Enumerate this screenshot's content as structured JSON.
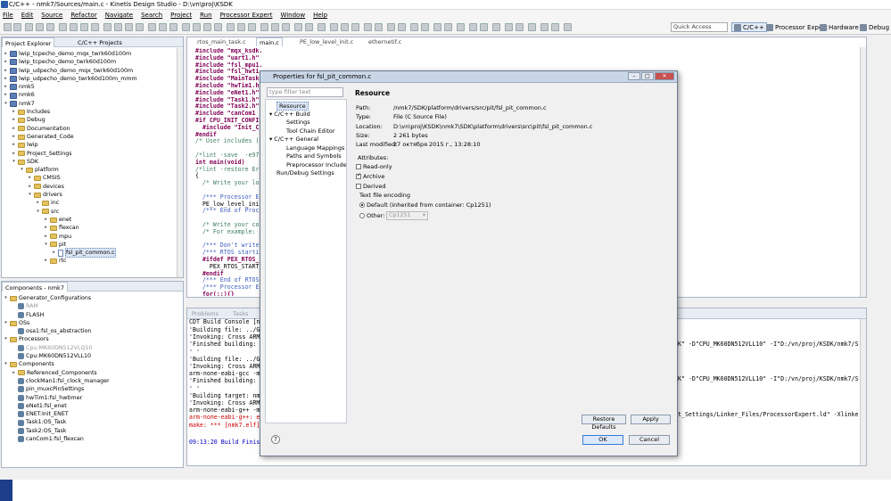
{
  "window": {
    "title": "C/C++ - nmk7/Sources/main.c - Kinetis Design Studio - D:\\vn\\proj\\KSDK"
  },
  "menu": [
    "File",
    "Edit",
    "Source",
    "Refactor",
    "Navigate",
    "Search",
    "Project",
    "Run",
    "Processor Expert",
    "Window",
    "Help"
  ],
  "toolbar": {
    "quick_access": "Quick Access"
  },
  "perspectives": [
    "C/C++",
    "Processor Expert",
    "Hardware",
    "Debug"
  ],
  "project_explorer": {
    "tabs": [
      "Project Explorer",
      "C/C++ Projects"
    ],
    "items": [
      {
        "label": "lwip_tcpecho_demo_mqx_twrk60d100m",
        "depth": 0,
        "kind": "project",
        "twisty": "▸"
      },
      {
        "label": "lwip_tcpecho_demo_twrk60d100m",
        "depth": 0,
        "kind": "project",
        "twisty": "▸"
      },
      {
        "label": "lwip_udpecho_demo_mqx_twrk60d100m",
        "depth": 0,
        "kind": "project",
        "twisty": "▸"
      },
      {
        "label": "lwip_udpecho_demo_twrk60d100m_mmm",
        "depth": 0,
        "kind": "project",
        "twisty": "▸"
      },
      {
        "label": "nmk5",
        "depth": 0,
        "kind": "project",
        "twisty": "▸"
      },
      {
        "label": "nmk6",
        "depth": 0,
        "kind": "project",
        "twisty": "▸"
      },
      {
        "label": "nmk7",
        "depth": 0,
        "kind": "project",
        "twisty": "▾"
      },
      {
        "label": "Includes",
        "depth": 1,
        "kind": "folder",
        "twisty": "▸"
      },
      {
        "label": "Debug",
        "depth": 1,
        "kind": "folder",
        "twisty": "▸"
      },
      {
        "label": "Documentation",
        "depth": 1,
        "kind": "folder",
        "twisty": "▸"
      },
      {
        "label": "Generated_Code",
        "depth": 1,
        "kind": "folder",
        "twisty": "▸"
      },
      {
        "label": "lwip",
        "depth": 1,
        "kind": "folder",
        "twisty": "▸"
      },
      {
        "label": "Project_Settings",
        "depth": 1,
        "kind": "folder",
        "twisty": "▸"
      },
      {
        "label": "SDK",
        "depth": 1,
        "kind": "folder",
        "twisty": "▾"
      },
      {
        "label": "platform",
        "depth": 2,
        "kind": "folder",
        "twisty": "▾"
      },
      {
        "label": "CMSIS",
        "depth": 3,
        "kind": "folder",
        "twisty": "▸"
      },
      {
        "label": "devices",
        "depth": 3,
        "kind": "folder",
        "twisty": "▸"
      },
      {
        "label": "drivers",
        "depth": 3,
        "kind": "folder",
        "twisty": "▾"
      },
      {
        "label": "inc",
        "depth": 4,
        "kind": "folder",
        "twisty": "▸"
      },
      {
        "label": "src",
        "depth": 4,
        "kind": "folder",
        "twisty": "▾"
      },
      {
        "label": "enet",
        "depth": 5,
        "kind": "folder",
        "twisty": "▸"
      },
      {
        "label": "flexcan",
        "depth": 5,
        "kind": "folder",
        "twisty": "▸"
      },
      {
        "label": "mpu",
        "depth": 5,
        "kind": "folder",
        "twisty": "▸"
      },
      {
        "label": "pit",
        "depth": 5,
        "kind": "folder",
        "twisty": "▾"
      },
      {
        "label": "fsl_pit_common.c",
        "depth": 6,
        "kind": "file",
        "twisty": "▸",
        "selected": true
      },
      {
        "label": "rtc",
        "depth": 5,
        "kind": "folder",
        "twisty": "▸"
      }
    ]
  },
  "components": {
    "tab": "Components - nmk7",
    "items": [
      {
        "label": "Generator_Configurations",
        "depth": 0,
        "kind": "folder",
        "twisty": "▾"
      },
      {
        "label": "RAM",
        "depth": 1,
        "kind": "comp",
        "grey": true
      },
      {
        "label": "FLASH",
        "depth": 1,
        "kind": "comp"
      },
      {
        "label": "OSs",
        "depth": 0,
        "kind": "folder",
        "twisty": "▾"
      },
      {
        "label": "osa1:fsl_os_abstraction",
        "depth": 1,
        "kind": "comp"
      },
      {
        "label": "Processors",
        "depth": 0,
        "kind": "folder",
        "twisty": "▾"
      },
      {
        "label": "Cpu:MK60DN512VLQ10",
        "depth": 1,
        "kind": "comp",
        "grey": true
      },
      {
        "label": "Cpu:MK60DN512VLL10",
        "depth": 1,
        "kind": "comp"
      },
      {
        "label": "Components",
        "depth": 0,
        "kind": "folder",
        "twisty": "▾"
      },
      {
        "label": "Referenced_Components",
        "depth": 1,
        "kind": "folder",
        "twisty": "▸"
      },
      {
        "label": "clockMan1:fsl_clock_manager",
        "depth": 1,
        "kind": "comp"
      },
      {
        "label": "pin_muxcPinSettings",
        "depth": 1,
        "kind": "comp"
      },
      {
        "label": "hwTim1:fsl_hwtimer",
        "depth": 1,
        "kind": "comp"
      },
      {
        "label": "eNet1:fsl_enet",
        "depth": 1,
        "kind": "comp"
      },
      {
        "label": "ENET:Init_ENET",
        "depth": 1,
        "kind": "comp"
      },
      {
        "label": "Task1:OS_Task",
        "depth": 1,
        "kind": "comp"
      },
      {
        "label": "Task2:OS_Task",
        "depth": 1,
        "kind": "comp"
      },
      {
        "label": "canCom1:fsl_flexcan",
        "depth": 1,
        "kind": "comp"
      }
    ]
  },
  "editor": {
    "tabs": [
      "rtos_main_task.c",
      "main.c",
      "PE_low_level_init.c",
      "ethernetif.c"
    ],
    "active_tab": 1,
    "lines": [
      {
        "t": "#include \"mqx_ksdk.h\"",
        "k": "inc"
      },
      {
        "t": "#include \"uart1.h\"",
        "k": "inc"
      },
      {
        "t": "#include \"fsl_mpu1.h\"",
        "k": "inc"
      },
      {
        "t": "#include \"fsl_hwti",
        "k": "inc"
      },
      {
        "t": "#include \"MainTask",
        "k": "inc"
      },
      {
        "t": "#include \"hwTim1.h",
        "k": "inc"
      },
      {
        "t": "#include \"eNet1.h\"",
        "k": "inc"
      },
      {
        "t": "#include \"Task1.h\"",
        "k": "inc"
      },
      {
        "t": "#include \"Task2.h\"",
        "k": "inc"
      },
      {
        "t": "#include \"canCom1",
        "k": "inc"
      },
      {
        "t": "#if CPU_INIT_CONFIG",
        "k": "kw"
      },
      {
        "t": "  #include \"Init_C",
        "k": "inc"
      },
      {
        "t": "#endif",
        "k": "kw"
      },
      {
        "t": "/* User includes (",
        "k": "cm"
      },
      {
        "t": "",
        "k": ""
      },
      {
        "t": "/*lint -save  -e97",
        "k": "cm"
      },
      {
        "t": "int main(void)",
        "k": "kw"
      },
      {
        "t": "/*lint -restore Er",
        "k": "cm"
      },
      {
        "t": "{",
        "k": ""
      },
      {
        "t": "  /* Write your lo",
        "k": "cm"
      },
      {
        "t": "",
        "k": ""
      },
      {
        "t": "  /*** Processor E",
        "k": "cmb"
      },
      {
        "t": "  PE_low_level_ini",
        "k": ""
      },
      {
        "t": "  /*** End of Proc",
        "k": "cmb"
      },
      {
        "t": "",
        "k": ""
      },
      {
        "t": "  /* Write your co",
        "k": "cm"
      },
      {
        "t": "  /* For example:",
        "k": "cm"
      },
      {
        "t": "",
        "k": ""
      },
      {
        "t": "  /*** Don't write",
        "k": "cmb"
      },
      {
        "t": "  /*** RTOS starti",
        "k": "cmb"
      },
      {
        "t": "  #ifdef PEX_RTOS_",
        "k": "kw"
      },
      {
        "t": "    PEX_RTOS_START",
        "k": ""
      },
      {
        "t": "  #endif",
        "k": "kw"
      },
      {
        "t": "  /*** End of RTOS",
        "k": "cmb"
      },
      {
        "t": "  /*** Processor E",
        "k": "cmb"
      },
      {
        "t": "  for(;;){}",
        "k": "kw"
      }
    ]
  },
  "console": {
    "tabs": [
      "Problems",
      "Tasks"
    ],
    "header": "CDT Build Console [nmk7]",
    "lines": [
      "'Building file: ../Gen",
      "'Invoking: Cross ARM G",
      "'Finished building: ..",
      "' '",
      "'Building file: ../Gen",
      "'Invoking: Cross ARM G",
      "arm-none-eabi-gcc -mcp",
      "'Finished building: ..",
      "' '",
      "'Building target: nmk7",
      "'Invoking: Cross ARM C",
      "arm-none-eabi-g++ -mcp",
      "arm-none-eabi-g++: err",
      "make: *** [nmk7.elf] E"
    ],
    "tail_lines": [
      "K\" -D\"CPU_MK60DN512VLL10\" -I\"D:/vn/proj/KSDK/nmk7/SDK/pla",
      "K\" -D\"CPU_MK60DN512VLL10\" -I\"D:/vn/proj/KSDK/nmk7/SDK/pla",
      "t_Settings/Linker_Files/ProcessorExpert.ld\" -Xlinker --gc"
    ],
    "finished": "09:13:20 Build Finishe"
  },
  "dialog": {
    "title": "Properties for fsl_pit_common.c",
    "filter_placeholder": "type filter text",
    "nav": [
      {
        "label": "Resource",
        "depth": 0,
        "selected": true
      },
      {
        "label": "C/C++ Build",
        "depth": 0,
        "twisty": "▾"
      },
      {
        "label": "Settings",
        "depth": 1
      },
      {
        "label": "Tool Chain Editor",
        "depth": 1
      },
      {
        "label": "C/C++ General",
        "depth": 0,
        "twisty": "▾"
      },
      {
        "label": "Language Mappings",
        "depth": 1
      },
      {
        "label": "Paths and Symbols",
        "depth": 1
      },
      {
        "label": "Preprocessor Include Pa",
        "depth": 1
      },
      {
        "label": "Run/Debug Settings",
        "depth": 0
      }
    ],
    "section_title": "Resource",
    "props": [
      {
        "k": "Path:",
        "v": "/nmk7/SDK/platform/drivers/src/pit/fsl_pit_common.c"
      },
      {
        "k": "Type:",
        "v": "File  (C Source File)"
      },
      {
        "k": "Location:",
        "v": "D:\\vn\\proj\\KSDK\\nmk7\\SDK\\platform\\drivers\\src\\pit\\fsl_pit_common.c"
      },
      {
        "k": "Size:",
        "v": "2 261  bytes"
      },
      {
        "k": "Last modified:",
        "v": "27 октября 2015 г., 13:28:10"
      }
    ],
    "attributes_label": "Attributes:",
    "attrs": [
      {
        "label": "Read-only",
        "checked": false
      },
      {
        "label": "Archive",
        "checked": true
      },
      {
        "label": "Derived",
        "checked": false
      }
    ],
    "encoding_label": "Text file encoding",
    "enc_default": "Default (inherited from container: Cp1251)",
    "enc_other": "Other:",
    "enc_other_value": "Cp1251",
    "restore_btn": "Restore Defaults",
    "apply_btn": "Apply",
    "ok_btn": "OK",
    "cancel_btn": "Cancel"
  }
}
